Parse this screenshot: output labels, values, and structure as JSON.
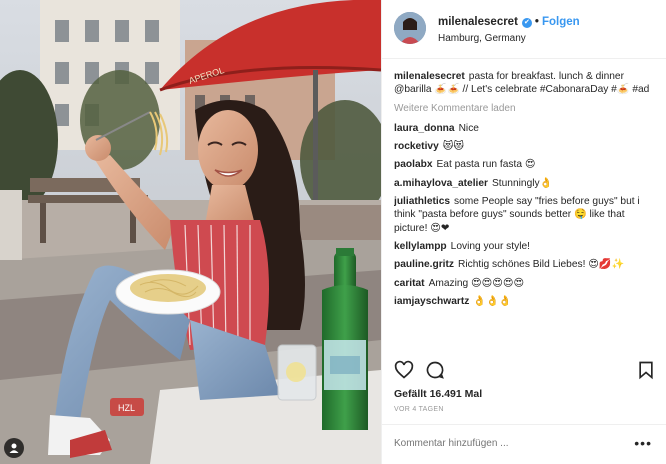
{
  "header": {
    "username": "milenalesecret",
    "verified_mark": "✔",
    "separator": "•",
    "follow_label": "Folgen",
    "location": "Hamburg, Germany"
  },
  "caption": {
    "username": "milenalesecret",
    "text": "pasta for breakfast. lunch & dinner @barilla 🍝🍝 // Let's celebrate #CabonaraDay #🍝 #ad"
  },
  "load_more_label": "Weitere Kommentare laden",
  "comments": [
    {
      "user": "laura_donna",
      "text": "Nice"
    },
    {
      "user": "rocketivy",
      "text": "😻😻"
    },
    {
      "user": "paolabx",
      "text": "Eat pasta run fasta 😍"
    },
    {
      "user": "a.mihaylova_atelier",
      "text": "Stunningly👌"
    },
    {
      "user": "juliathletics",
      "text": "some People say \"fries before guys\" but i think \"pasta before guys\" sounds better 🤤 like that picture! 😍❤"
    },
    {
      "user": "kellylampp",
      "text": "Loving your style!"
    },
    {
      "user": "pauline.gritz",
      "text": "Richtig schönes Bild Liebes! 😍💋✨"
    },
    {
      "user": "caritat",
      "text": "Amazing 😍😍😍😍😍"
    },
    {
      "user": "iamjayschwartz",
      "text": "👌👌👌"
    }
  ],
  "actions": {
    "like_icon": "heart-icon",
    "comment_icon": "comment-icon",
    "save_icon": "bookmark-icon"
  },
  "likes_text": "Gefällt 16.491 Mal",
  "date_text": "VOR 4 TAGEN",
  "add_comment": {
    "placeholder": "Kommentar hinzufügen ...",
    "options_label": "•••"
  },
  "photo": {
    "description_icon": "tagged-user-icon",
    "umbrella_text": "APEROL",
    "cup_text": "HZL"
  },
  "colors": {
    "link_blue": "#3897f0",
    "text_dark": "#262626",
    "text_muted": "#999999",
    "border": "#efefef"
  }
}
